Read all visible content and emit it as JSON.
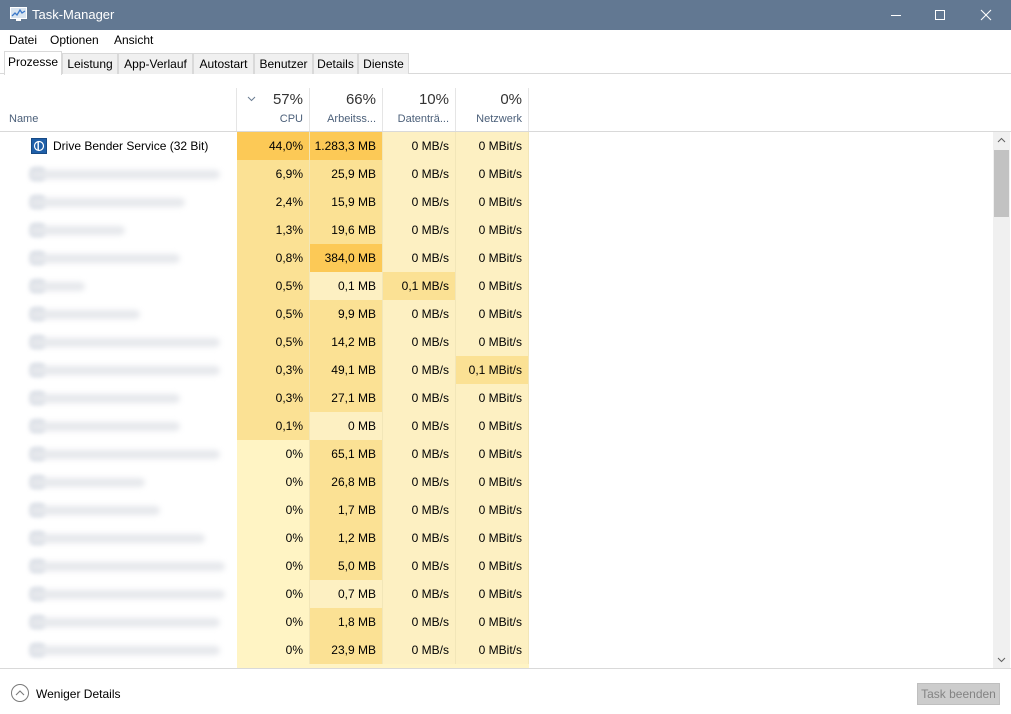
{
  "window": {
    "title": "Task-Manager"
  },
  "menu": [
    "Datei",
    "Optionen",
    "Ansicht"
  ],
  "tabs": [
    "Prozesse",
    "Leistung",
    "App-Verlauf",
    "Autostart",
    "Benutzer",
    "Details",
    "Dienste"
  ],
  "active_tab": "Prozesse",
  "columns": {
    "name": "Name",
    "cpu": {
      "percent": "57%",
      "label": "CPU"
    },
    "memory": {
      "percent": "66%",
      "label": "Arbeitss..."
    },
    "disk": {
      "percent": "10%",
      "label": "Datenträ..."
    },
    "network": {
      "percent": "0%",
      "label": "Netzwerk"
    }
  },
  "rows": [
    {
      "name": "Drive Bender Service (32 Bit)",
      "cpu": "44,0%",
      "mem": "1.283,3 MB",
      "disk": "0 MB/s",
      "net": "0 MBit/s"
    },
    {
      "name": "",
      "cpu": "6,9%",
      "mem": "25,9 MB",
      "disk": "0 MB/s",
      "net": "0 MBit/s"
    },
    {
      "name": "",
      "cpu": "2,4%",
      "mem": "15,9 MB",
      "disk": "0 MB/s",
      "net": "0 MBit/s"
    },
    {
      "name": "",
      "cpu": "1,3%",
      "mem": "19,6 MB",
      "disk": "0 MB/s",
      "net": "0 MBit/s"
    },
    {
      "name": "",
      "cpu": "0,8%",
      "mem": "384,0 MB",
      "disk": "0 MB/s",
      "net": "0 MBit/s"
    },
    {
      "name": "",
      "cpu": "0,5%",
      "mem": "0,1 MB",
      "disk": "0,1 MB/s",
      "net": "0 MBit/s"
    },
    {
      "name": "",
      "cpu": "0,5%",
      "mem": "9,9 MB",
      "disk": "0 MB/s",
      "net": "0 MBit/s"
    },
    {
      "name": "",
      "cpu": "0,5%",
      "mem": "14,2 MB",
      "disk": "0 MB/s",
      "net": "0 MBit/s"
    },
    {
      "name": "",
      "cpu": "0,3%",
      "mem": "49,1 MB",
      "disk": "0 MB/s",
      "net": "0,1 MBit/s"
    },
    {
      "name": "",
      "cpu": "0,3%",
      "mem": "27,1 MB",
      "disk": "0 MB/s",
      "net": "0 MBit/s"
    },
    {
      "name": "",
      "cpu": "0,1%",
      "mem": "0 MB",
      "disk": "0 MB/s",
      "net": "0 MBit/s"
    },
    {
      "name": "",
      "cpu": "0%",
      "mem": "65,1 MB",
      "disk": "0 MB/s",
      "net": "0 MBit/s"
    },
    {
      "name": "",
      "cpu": "0%",
      "mem": "26,8 MB",
      "disk": "0 MB/s",
      "net": "0 MBit/s"
    },
    {
      "name": "",
      "cpu": "0%",
      "mem": "1,7 MB",
      "disk": "0 MB/s",
      "net": "0 MBit/s"
    },
    {
      "name": "",
      "cpu": "0%",
      "mem": "1,2 MB",
      "disk": "0 MB/s",
      "net": "0 MBit/s"
    },
    {
      "name": "",
      "cpu": "0%",
      "mem": "5,0 MB",
      "disk": "0 MB/s",
      "net": "0 MBit/s"
    },
    {
      "name": "",
      "cpu": "0%",
      "mem": "0,7 MB",
      "disk": "0 MB/s",
      "net": "0 MBit/s"
    },
    {
      "name": "",
      "cpu": "0%",
      "mem": "1,8 MB",
      "disk": "0 MB/s",
      "net": "0 MBit/s"
    },
    {
      "name": "",
      "cpu": "0%",
      "mem": "23,9 MB",
      "disk": "0 MB/s",
      "net": "0 MBit/s"
    }
  ],
  "footer": {
    "less_details": "Weniger Details",
    "end_task": "Task beenden"
  },
  "colors": {
    "titlebar": "#627892",
    "heat_high": "#fcc956",
    "heat_mid": "#fbe194",
    "heat_low": "#fdf0c2",
    "heat_none": "#fff4c4",
    "header_label": "#4c607a"
  },
  "icons": {
    "app": "task-manager-icon",
    "process": "drive-bender-icon",
    "collapse": "chevron-up-circle-icon",
    "sort": "chevron-down-icon"
  }
}
